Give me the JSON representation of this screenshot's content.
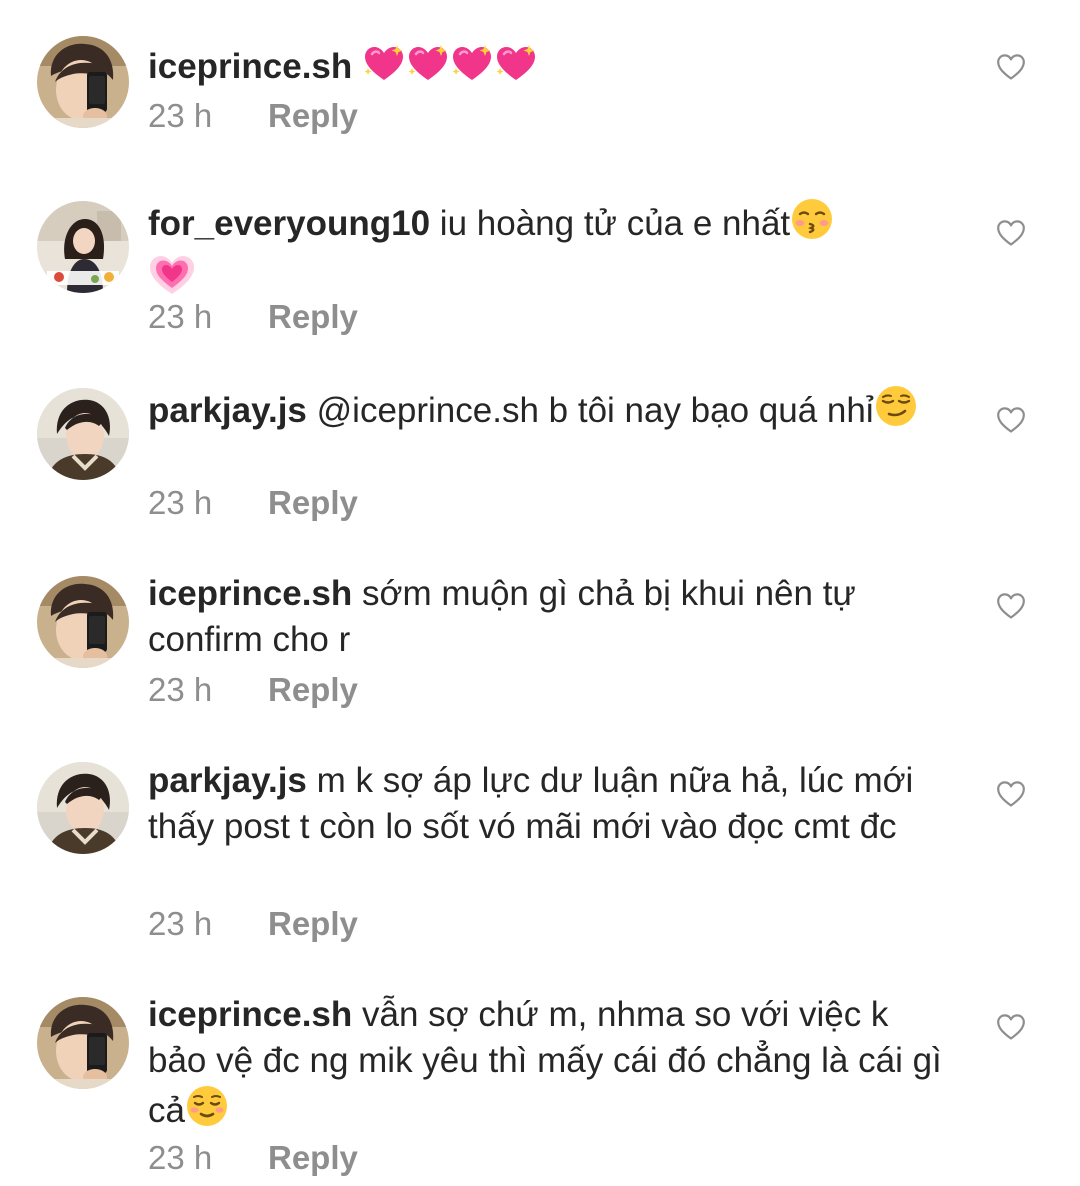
{
  "comments": [
    {
      "username": "iceprince.sh",
      "text": "",
      "emoji": "sparkling-heart x4",
      "time": "23 h",
      "reply": "Reply"
    },
    {
      "username": "for_everyoung10",
      "text": "iu hoàng tử của e nhất",
      "emoji": "kissing-face, growing-heart",
      "time": "23 h",
      "reply": "Reply"
    },
    {
      "username": "parkjay.js",
      "text": "@iceprince.sh b tôi nay bạo quá nhỉ",
      "emoji": "smirking-face",
      "time": "23 h",
      "reply": "Reply"
    },
    {
      "username": "iceprince.sh",
      "text": "sớm muộn gì chả bị khui nên tự confirm cho r",
      "time": "23 h",
      "reply": "Reply"
    },
    {
      "username": "parkjay.js",
      "text": "m k sợ áp lực dư luận nữa hả, lúc mới thấy post t còn lo sốt vó mãi mới vào đọc cmt đc",
      "time": "23 h",
      "reply": "Reply"
    },
    {
      "username": "iceprince.sh",
      "text": "vẫn sợ chứ m, nhma so với việc k bảo vệ đc ng mik yêu thì mấy cái đó chẳng là cái gì cả",
      "emoji": "relieved-face",
      "time": "23 h",
      "reply": "Reply"
    }
  ],
  "icons": {
    "like": "heart-outline-icon"
  },
  "colors": {
    "text": "#262626",
    "meta": "#8e8e8e",
    "icon": "#8e8e8e"
  }
}
